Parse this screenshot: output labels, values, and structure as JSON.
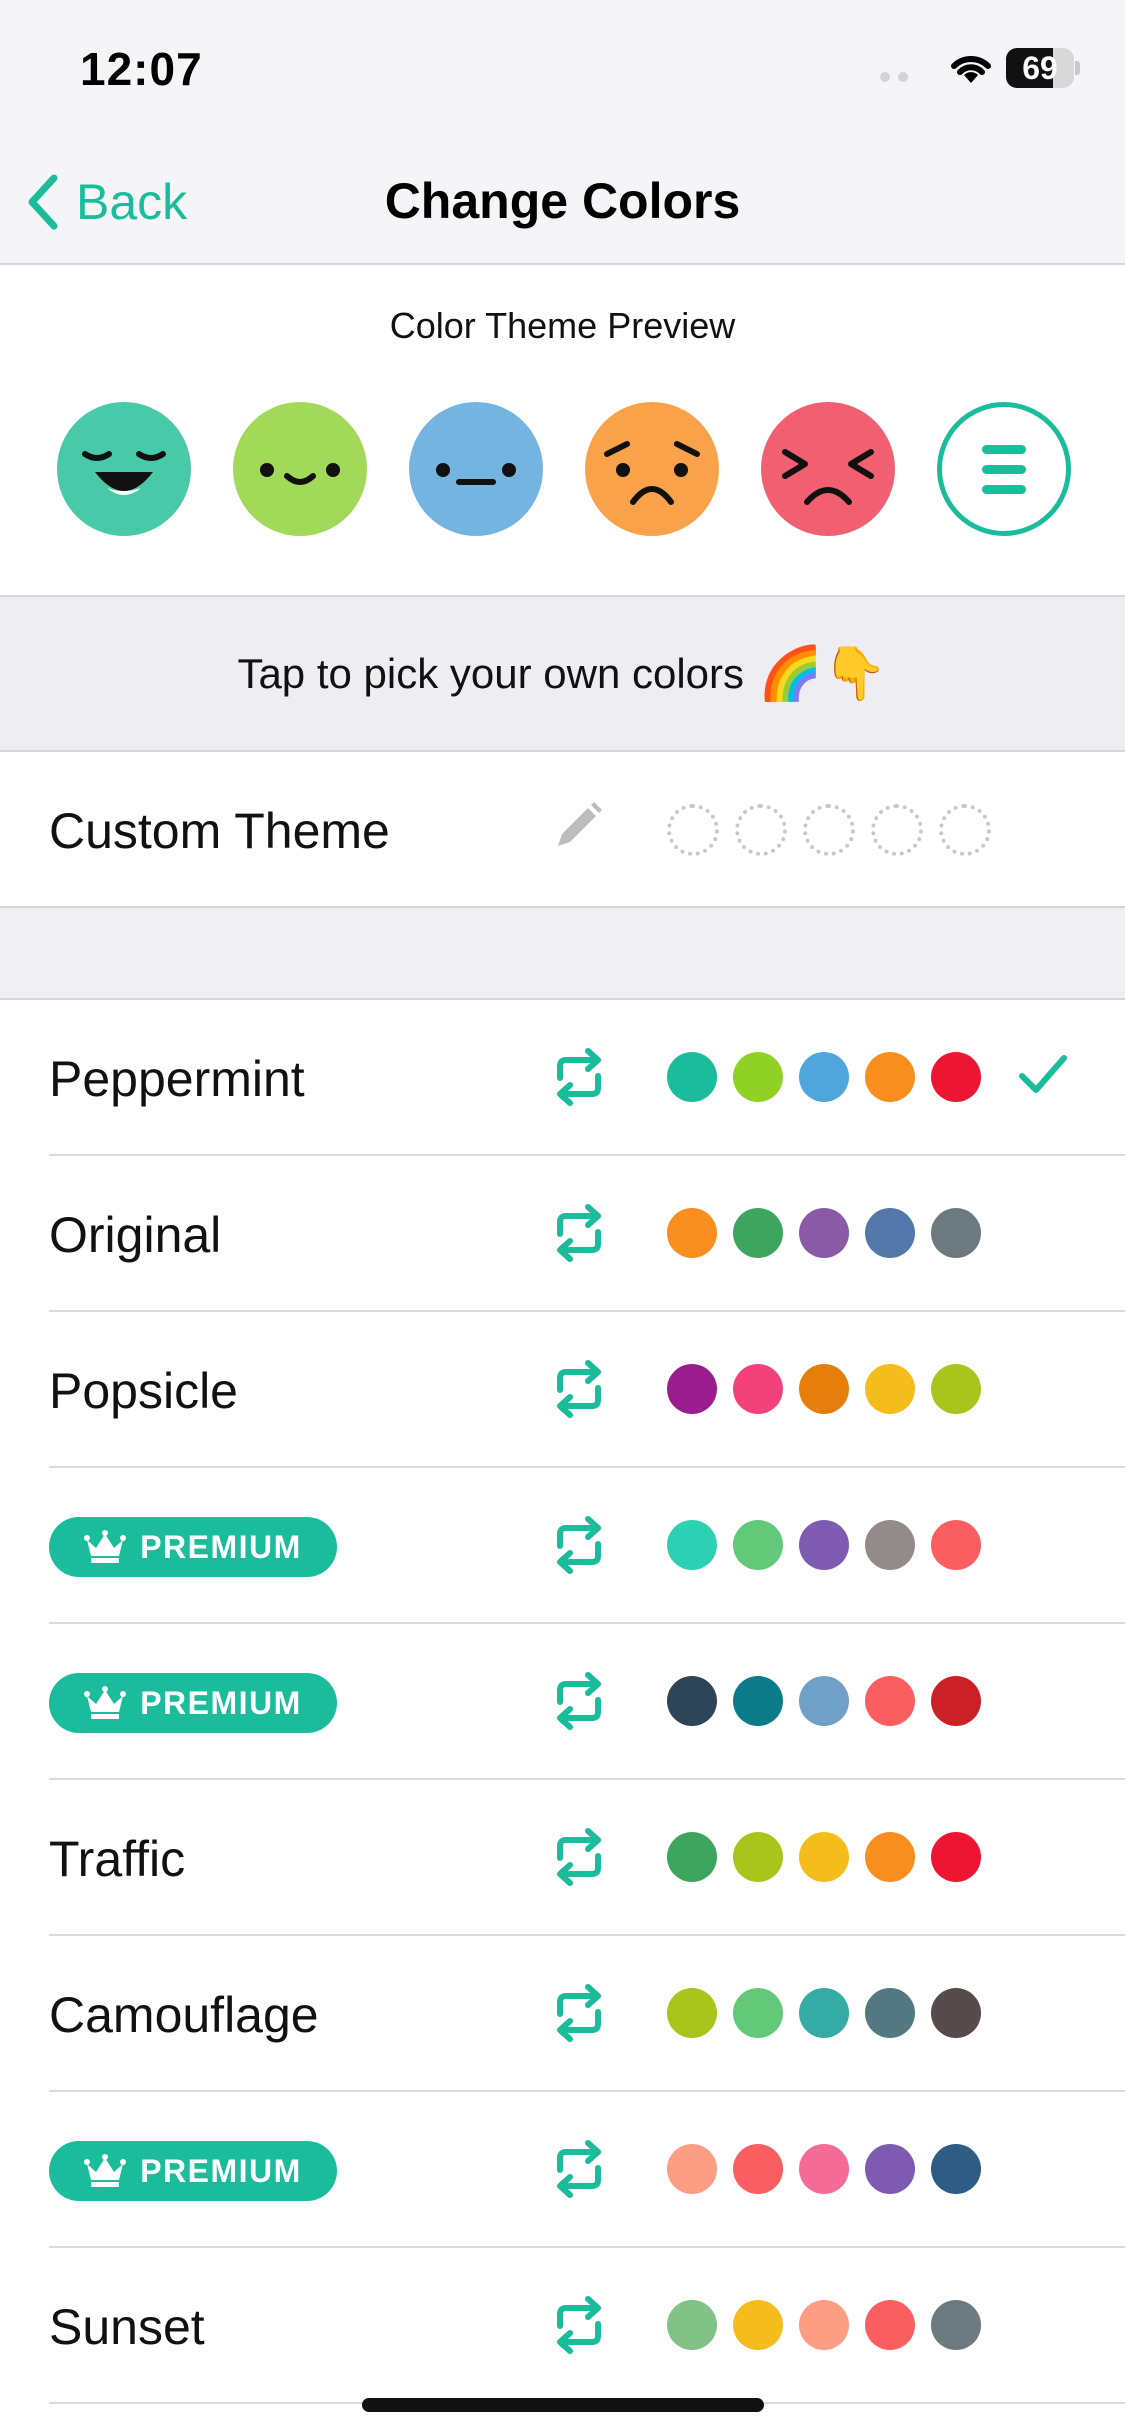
{
  "status_bar": {
    "time": "12:07",
    "battery": "69",
    "battery_level": 0.69
  },
  "nav": {
    "back_label": "Back",
    "title": "Change Colors",
    "accent": "#1abc9c"
  },
  "preview": {
    "title": "Color Theme Preview",
    "faces": [
      {
        "name": "laughing-face",
        "color": "#48c9a8"
      },
      {
        "name": "smiling-face",
        "color": "#a3d959"
      },
      {
        "name": "neutral-face",
        "color": "#74b4e0"
      },
      {
        "name": "frowning-face",
        "color": "#f9a24a"
      },
      {
        "name": "miserable-face",
        "color": "#f25f70"
      }
    ],
    "menu_icon": "hamburger-menu-icon"
  },
  "tap_banner": {
    "text": "Tap to pick your own colors",
    "emoji": "🌈👇"
  },
  "custom_theme": {
    "label": "Custom Theme",
    "icon": "pencil-icon"
  },
  "themes": [
    {
      "label": "Peppermint",
      "premium": false,
      "selected": true,
      "colors": [
        "#1abc9c",
        "#8fd125",
        "#4ea6dc",
        "#f78e1e",
        "#ee1532"
      ]
    },
    {
      "label": "Original",
      "premium": false,
      "selected": false,
      "colors": [
        "#f78e1e",
        "#3ea55f",
        "#8b5aa6",
        "#5477a9",
        "#6c7a80"
      ]
    },
    {
      "label": "Popsicle",
      "premium": false,
      "selected": false,
      "colors": [
        "#9b1c8c",
        "#f2417b",
        "#e67e0c",
        "#f4bd1c",
        "#a9c41b"
      ]
    },
    {
      "label": "PREMIUM",
      "premium": true,
      "selected": false,
      "colors": [
        "#2dd0b2",
        "#62c979",
        "#7e5bb0",
        "#938b89",
        "#fb5e61"
      ]
    },
    {
      "label": "PREMIUM",
      "premium": true,
      "selected": false,
      "colors": [
        "#2d4557",
        "#0b7b8a",
        "#70a0c5",
        "#fb5e61",
        "#cc2027"
      ]
    },
    {
      "label": "Traffic",
      "premium": false,
      "selected": false,
      "colors": [
        "#3ea55f",
        "#a9c41b",
        "#f4bd1c",
        "#f78e1e",
        "#ee1532"
      ]
    },
    {
      "label": "Camouflage",
      "premium": false,
      "selected": false,
      "colors": [
        "#a9c41b",
        "#62c979",
        "#35aba5",
        "#547882",
        "#574a4a"
      ]
    },
    {
      "label": "PREMIUM",
      "premium": true,
      "selected": false,
      "colors": [
        "#fd9d84",
        "#fb5e61",
        "#f56b97",
        "#7e5bb0",
        "#2f5c84"
      ]
    },
    {
      "label": "Sunset",
      "premium": false,
      "selected": false,
      "colors": [
        "#82c287",
        "#f4bd1c",
        "#fd9d84",
        "#fb5e61",
        "#6c7a80"
      ]
    }
  ]
}
